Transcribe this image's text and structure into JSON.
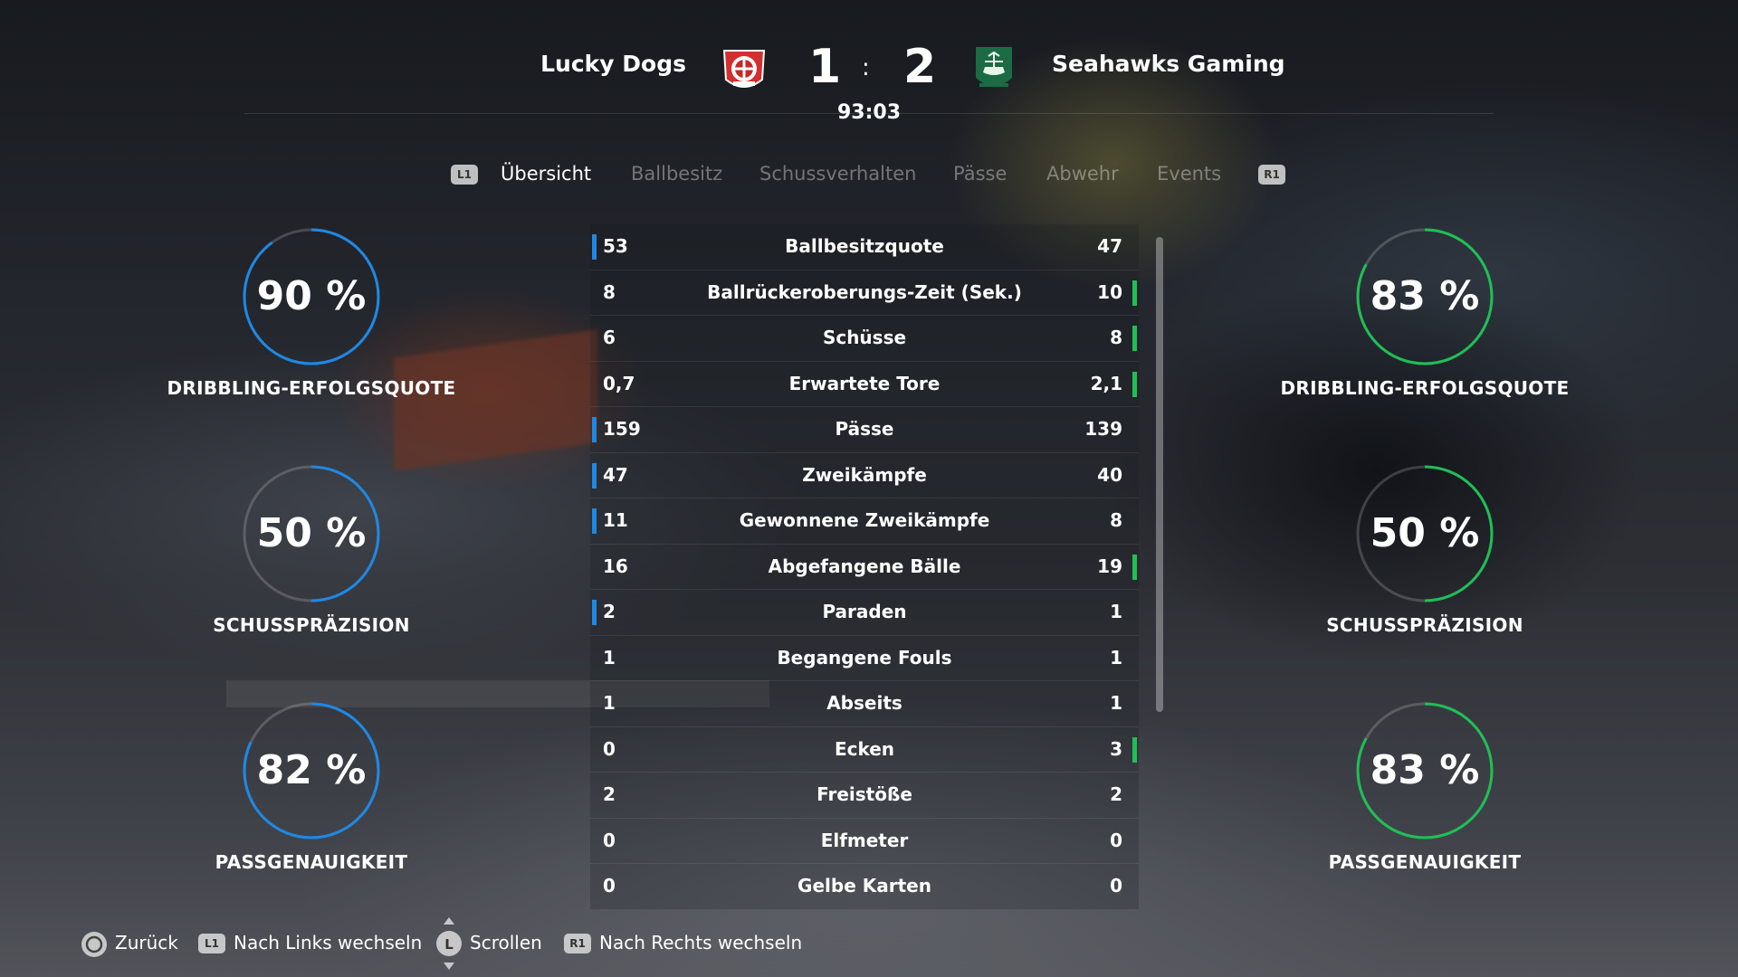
{
  "match": {
    "home_team": "Lucky Dogs",
    "away_team": "Seahawks Gaming",
    "home_score": "1",
    "away_score": "2",
    "separator": ":",
    "clock": "93:03"
  },
  "tabs": {
    "left_button": "L1",
    "right_button": "R1",
    "items": [
      "Übersicht",
      "Ballbesitz",
      "Schussverhalten",
      "Pässe",
      "Abwehr",
      "Events"
    ],
    "active": "Übersicht"
  },
  "gauges": {
    "left": [
      {
        "value": "90 %",
        "fraction": 0.9,
        "label": "DRIBBLING-ERFOLGSQUOTE"
      },
      {
        "value": "50 %",
        "fraction": 0.5,
        "label": "SCHUSSPRÄZISION"
      },
      {
        "value": "82 %",
        "fraction": 0.82,
        "label": "PASSGENAUIGKEIT"
      }
    ],
    "right": [
      {
        "value": "83 %",
        "fraction": 0.83,
        "label": "DRIBBLING-ERFOLGSQUOTE"
      },
      {
        "value": "50 %",
        "fraction": 0.5,
        "label": "SCHUSSPRÄZISION"
      },
      {
        "value": "83 %",
        "fraction": 0.83,
        "label": "PASSGENAUIGKEIT"
      }
    ],
    "left_color": "#1e88e5",
    "right_color": "#1fbf55"
  },
  "stats": [
    {
      "name": "Ballbesitzquote",
      "home": "53",
      "away": "47",
      "leader": "home"
    },
    {
      "name": "Ballrückeroberungs-Zeit (Sek.)",
      "home": "8",
      "away": "10",
      "leader": "away"
    },
    {
      "name": "Schüsse",
      "home": "6",
      "away": "8",
      "leader": "away"
    },
    {
      "name": "Erwartete Tore",
      "home": "0,7",
      "away": "2,1",
      "leader": "away"
    },
    {
      "name": "Pässe",
      "home": "159",
      "away": "139",
      "leader": "home"
    },
    {
      "name": "Zweikämpfe",
      "home": "47",
      "away": "40",
      "leader": "home"
    },
    {
      "name": "Gewonnene Zweikämpfe",
      "home": "11",
      "away": "8",
      "leader": "home"
    },
    {
      "name": "Abgefangene Bälle",
      "home": "16",
      "away": "19",
      "leader": "away"
    },
    {
      "name": "Paraden",
      "home": "2",
      "away": "1",
      "leader": "home"
    },
    {
      "name": "Begangene Fouls",
      "home": "1",
      "away": "1",
      "leader": "none"
    },
    {
      "name": "Abseits",
      "home": "1",
      "away": "1",
      "leader": "none"
    },
    {
      "name": "Ecken",
      "home": "0",
      "away": "3",
      "leader": "away"
    },
    {
      "name": "Freistöße",
      "home": "2",
      "away": "2",
      "leader": "none"
    },
    {
      "name": "Elfmeter",
      "home": "0",
      "away": "0",
      "leader": "none"
    },
    {
      "name": "Gelbe Karten",
      "home": "0",
      "away": "0",
      "leader": "none"
    }
  ],
  "footer": {
    "back": "Zurück",
    "l1_badge": "L1",
    "left_switch": "Nach Links wechseln",
    "l_badge": "L",
    "scroll": "Scrollen",
    "r1_badge": "R1",
    "right_switch": "Nach Rechts wechseln"
  }
}
